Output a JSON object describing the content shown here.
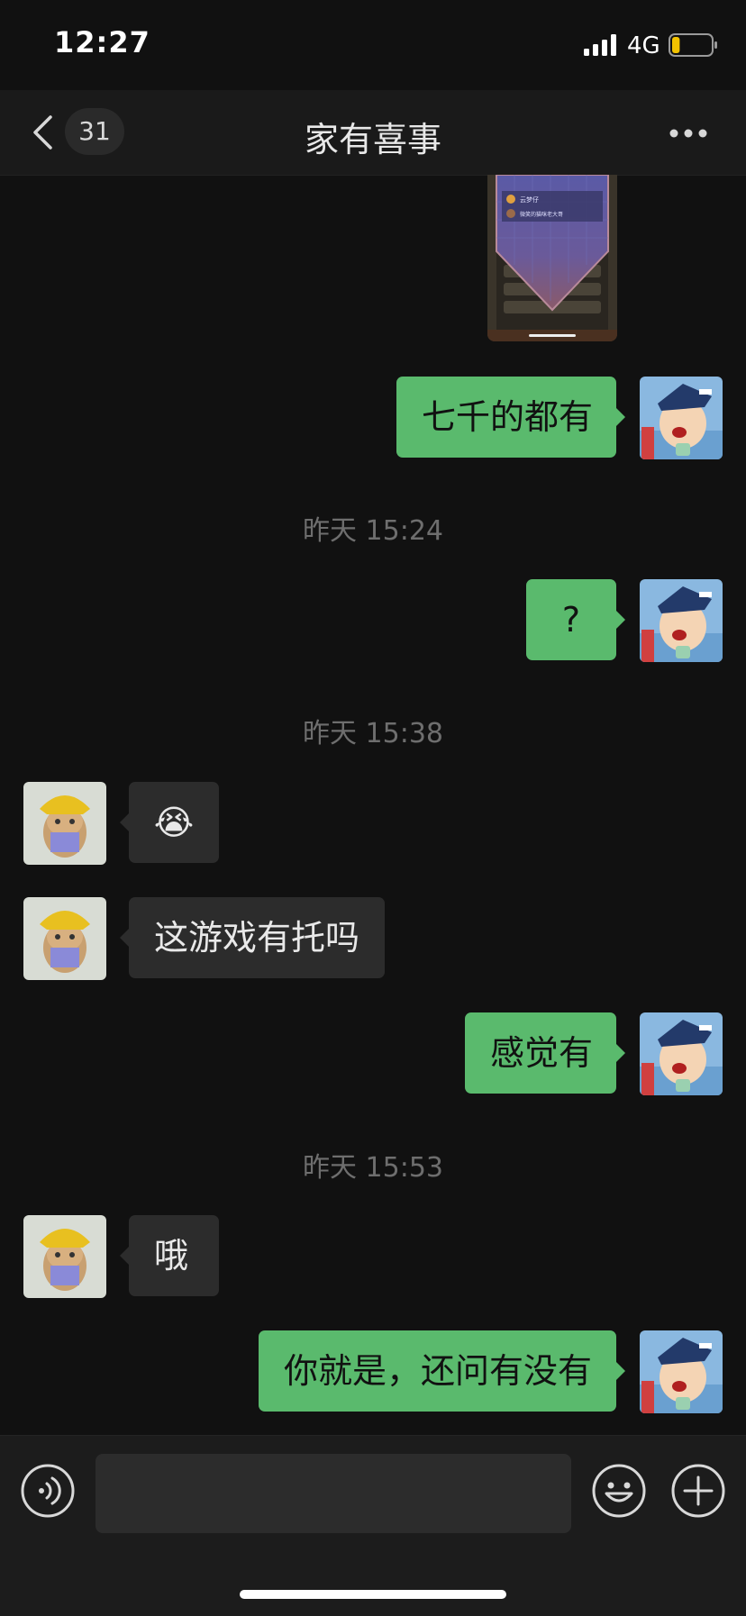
{
  "status_bar": {
    "time": "12:27",
    "network": "4G"
  },
  "nav": {
    "unread_count": "31",
    "title": "家有喜事"
  },
  "messages": {
    "m1": "七千的都有",
    "ts1": "昨天 15:24",
    "m2": "?",
    "ts2": "昨天 15:38",
    "m3_emoji": "😭",
    "m4": "这游戏有托吗",
    "m5": "感觉有",
    "ts3": "昨天 15:53",
    "m6": "哦",
    "m7": "你就是，还问有没有"
  },
  "shared_image_text": {
    "row1": "云梦仔",
    "row2": "微笑的猫咪老大哥"
  },
  "input": {
    "placeholder": "",
    "value": ""
  },
  "colors": {
    "background": "#111111",
    "outgoing_bubble": "#5aba6d",
    "incoming_bubble": "#2c2c2c",
    "battery_level": "#f2c200"
  },
  "battery_level": 0.2,
  "icons": [
    "back-icon",
    "more-icon",
    "voice-icon",
    "emoji-icon",
    "plus-icon",
    "signal-icon",
    "battery-icon"
  ]
}
